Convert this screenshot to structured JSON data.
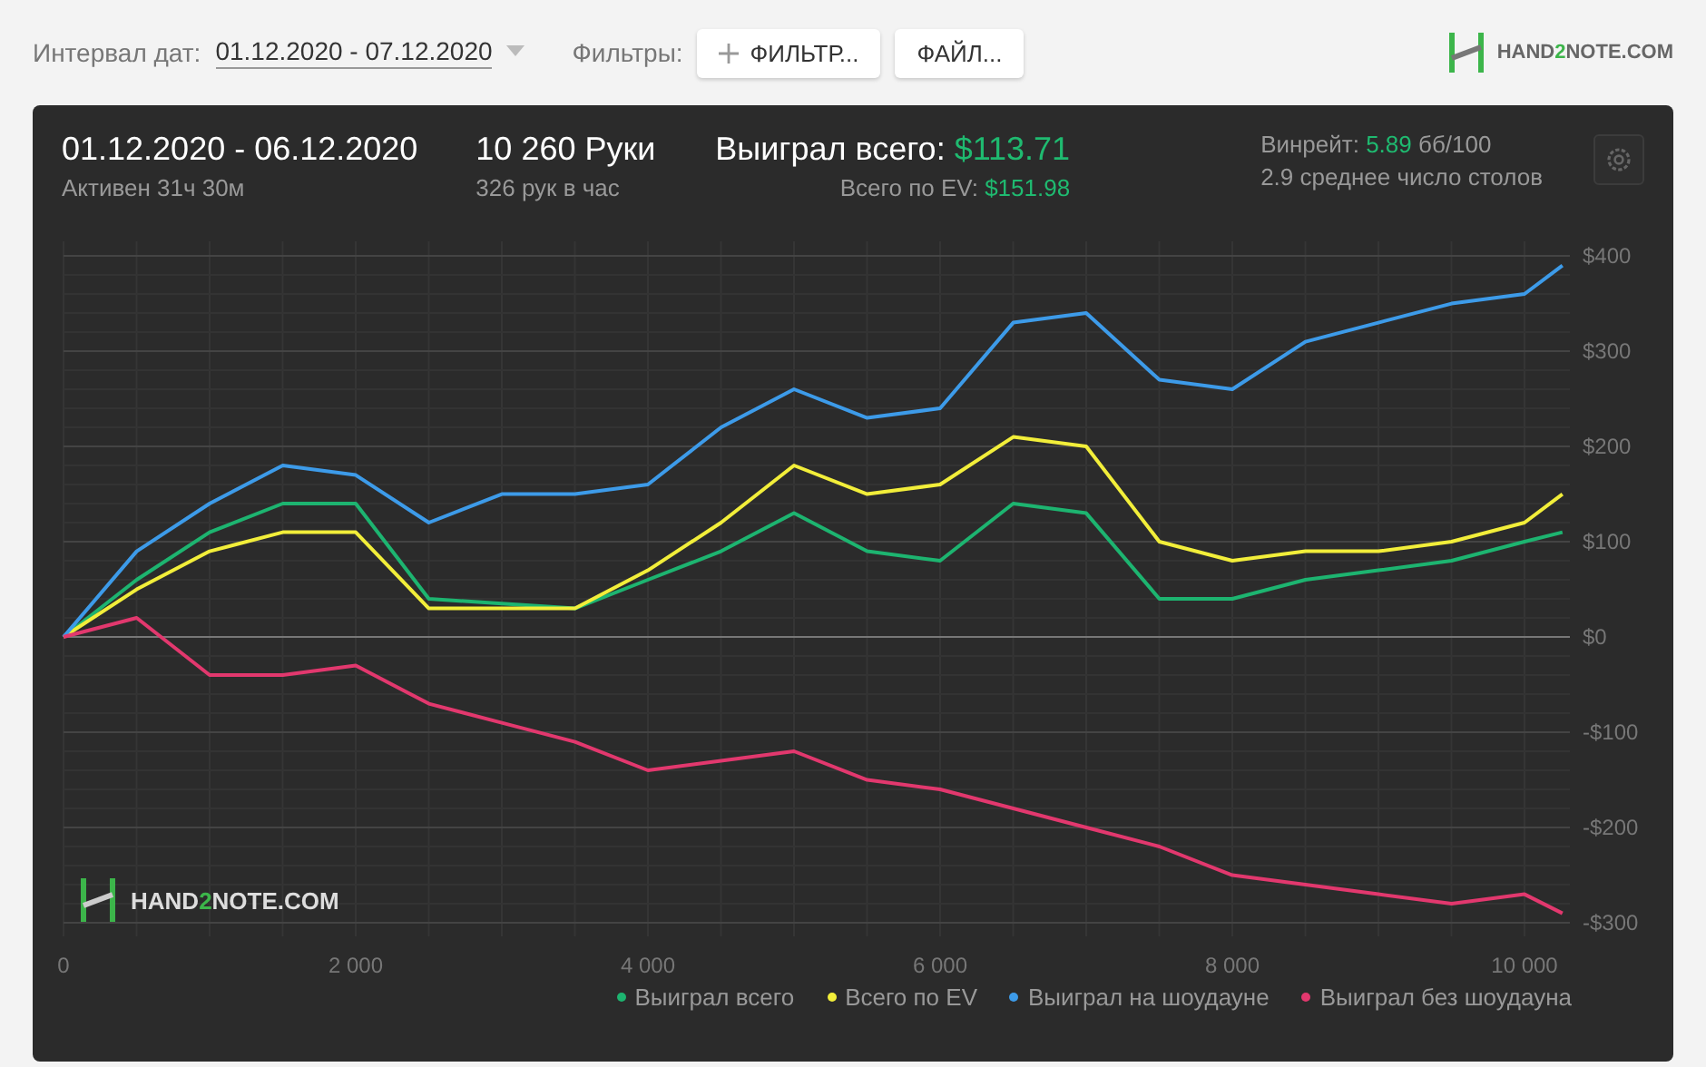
{
  "toolbar": {
    "date_label": "Интервал дат:",
    "date_value": "01.12.2020 - 07.12.2020",
    "filters_label": "Фильтры:",
    "filter_button": "ФИЛЬТР...",
    "file_button": "ФАЙЛ...",
    "logo": [
      "HAND",
      "2",
      "NOTE.COM"
    ]
  },
  "card": {
    "period": "01.12.2020 - 06.12.2020",
    "active": "Активен 31ч 30м",
    "hands": "10 260 Руки",
    "hands_rate": "326 рук в час",
    "won_label": "Выиграл всего:",
    "won_value": "$113.71",
    "ev_label": "Всего по EV:",
    "ev_value": "$151.98",
    "winrate_label": "Винрейт:",
    "winrate_value": "5.89",
    "winrate_unit": "бб/100",
    "tables": "2.9 среднее число столов",
    "watermark": [
      "HAND",
      "2",
      "NOTE.COM"
    ],
    "chart_data": {
      "type": "line",
      "x": [
        0,
        500,
        1000,
        1500,
        2000,
        2500,
        3000,
        3500,
        4000,
        4500,
        5000,
        5500,
        6000,
        6500,
        7000,
        7500,
        8000,
        8500,
        9000,
        9500,
        10000,
        10260
      ],
      "series": [
        {
          "name": "Выиграл всего",
          "color": "#1db470",
          "values": [
            0,
            60,
            110,
            140,
            140,
            40,
            35,
            30,
            60,
            90,
            130,
            90,
            80,
            140,
            130,
            40,
            40,
            60,
            70,
            80,
            100,
            110
          ]
        },
        {
          "name": "Всего по EV",
          "color": "#f2ee3a",
          "values": [
            0,
            50,
            90,
            110,
            110,
            30,
            30,
            30,
            70,
            120,
            180,
            150,
            160,
            210,
            200,
            100,
            80,
            90,
            90,
            100,
            120,
            150
          ]
        },
        {
          "name": "Выиграл на шоудауне",
          "color": "#3d9be9",
          "values": [
            0,
            90,
            140,
            180,
            170,
            120,
            150,
            150,
            160,
            220,
            260,
            230,
            240,
            330,
            340,
            270,
            260,
            310,
            330,
            350,
            360,
            390
          ]
        },
        {
          "name": "Выиграл без шоудауна",
          "color": "#e2386e",
          "values": [
            0,
            20,
            -40,
            -40,
            -30,
            -70,
            -90,
            -110,
            -140,
            -130,
            -120,
            -150,
            -160,
            -180,
            -200,
            -220,
            -250,
            -260,
            -270,
            -280,
            -270,
            -290
          ]
        }
      ],
      "grid": true,
      "legend": "bottom-right",
      "xlim": [
        0,
        10260
      ],
      "ylim": [
        -300,
        400
      ],
      "xticks": [
        {
          "value": 0,
          "label": "0"
        },
        {
          "value": 2000,
          "label": "2 000"
        },
        {
          "value": 4000,
          "label": "4 000"
        },
        {
          "value": 6000,
          "label": "6 000"
        },
        {
          "value": 8000,
          "label": "8 000"
        },
        {
          "value": 10000,
          "label": "10 000"
        }
      ],
      "yticks": [
        {
          "value": 400,
          "label": "$400"
        },
        {
          "value": 300,
          "label": "$300"
        },
        {
          "value": 200,
          "label": "$200"
        },
        {
          "value": 100,
          "label": "$100"
        },
        {
          "value": 0,
          "label": "$0"
        },
        {
          "value": -100,
          "label": "-$100"
        },
        {
          "value": -200,
          "label": "-$200"
        },
        {
          "value": -300,
          "label": "-$300"
        }
      ]
    }
  }
}
